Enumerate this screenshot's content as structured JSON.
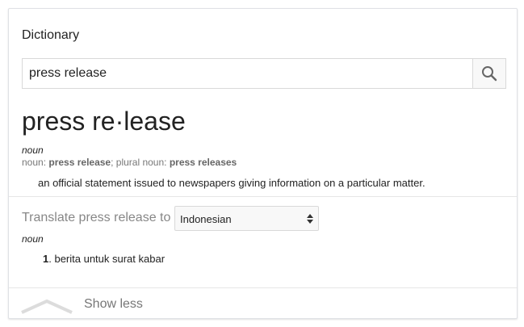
{
  "card": {
    "title": "Dictionary"
  },
  "search": {
    "value": "press release"
  },
  "entry": {
    "headword": "press re·lease",
    "part_of_speech": "noun",
    "forms_prefix": "noun: ",
    "form_singular": "press release",
    "forms_separator": "; plural noun: ",
    "form_plural": "press releases",
    "definition": "an official statement issued to newspapers giving information on a particular matter."
  },
  "translate": {
    "label": "Translate press release to",
    "language": "Indonesian",
    "part_of_speech": "noun",
    "sense_number": "1",
    "sense_text": ". berita untuk surat kabar"
  },
  "footer": {
    "toggle_label": "Show less"
  },
  "icons": {
    "search": "search-icon",
    "select_arrows": "updown-arrows-icon",
    "collapse": "chevron-up-icon"
  }
}
